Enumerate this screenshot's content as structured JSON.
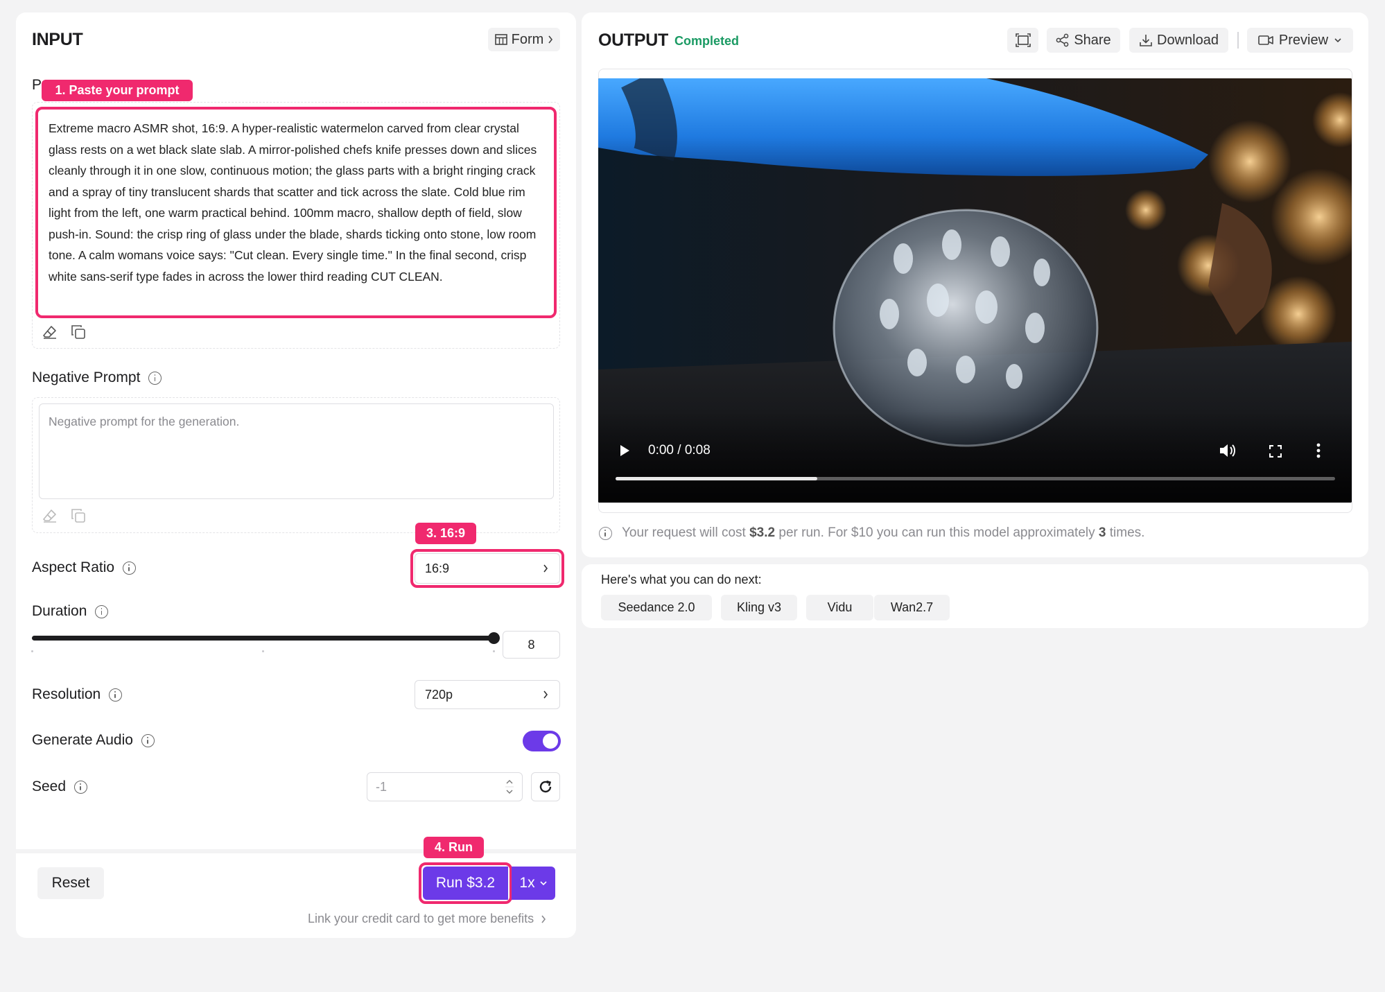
{
  "input": {
    "title": "INPUT",
    "form_button": "Form",
    "prompt_label_initial": "P",
    "prompt_text": "Extreme macro ASMR shot, 16:9. A hyper-realistic watermelon carved from clear crystal glass rests on a wet black slate slab. A mirror-polished chefs knife presses down and slices cleanly through it in one slow, continuous motion; the glass parts with a bright ringing crack and a spray of tiny translucent shards that scatter and tick across the slate. Cold blue rim light from the left, one warm practical behind. 100mm macro, shallow depth of field, slow push-in. Sound: the crisp ring of glass under the blade, shards ticking onto stone, low room tone. A calm womans voice says: \"Cut clean. Every single time.\" In the final second, crisp white sans-serif type fades in across the lower third reading CUT CLEAN.",
    "negative_prompt_label": "Negative Prompt",
    "negative_prompt_placeholder": "Negative prompt for the generation.",
    "aspect_ratio_label": "Aspect Ratio",
    "aspect_ratio_value": "16:9",
    "duration_label": "Duration",
    "duration_value": "8",
    "duration_fraction": 1.0,
    "resolution_label": "Resolution",
    "resolution_value": "720p",
    "generate_audio_label": "Generate Audio",
    "generate_audio_on": true,
    "seed_label": "Seed",
    "seed_placeholder": "-1",
    "reset_button": "Reset",
    "run_button": "Run $3.2",
    "multiplier": "1x",
    "credit_link": "Link your credit card to get more benefits"
  },
  "callouts": {
    "step1": "1. Paste your prompt",
    "step3": "3. 16:9",
    "step4": "4. Run"
  },
  "output": {
    "title": "OUTPUT",
    "status": "Completed",
    "share": "Share",
    "download": "Download",
    "preview": "Preview",
    "video_time": "0:00 / 0:08",
    "video_progress": 0.28,
    "cost_prefix": "Your request will cost ",
    "cost_value": "$3.2",
    "cost_middle": " per run. For $10 you can run this model approximately ",
    "cost_times": "3",
    "cost_suffix": " times."
  },
  "next": {
    "heading": "Here's what you can do next:",
    "models": [
      "Seedance 2.0",
      "Kling v3",
      "Vidu",
      "Wan2.7"
    ]
  },
  "colors": {
    "accent": "#6c3ae8",
    "callout": "#f0296e",
    "status": "#1a9a63"
  }
}
